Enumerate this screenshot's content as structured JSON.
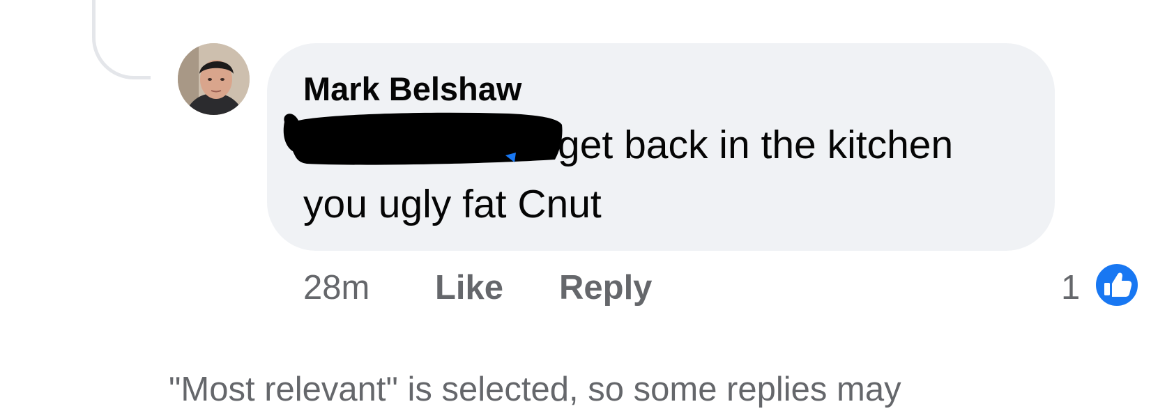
{
  "comment": {
    "author_name": "Mark Belshaw",
    "text_line_1": "get back in the kitchen",
    "text_line_2": "you ugly fat Cnut",
    "time": "28m",
    "like_label": "Like",
    "reply_label": "Reply",
    "reaction_count": "1",
    "reaction_icon": "thumbs-up-icon",
    "reaction_color": "#1877f2",
    "bubble_color": "#f0f2f5"
  },
  "notice": {
    "text": "\"Most relevant\" is selected, so some replies may"
  }
}
